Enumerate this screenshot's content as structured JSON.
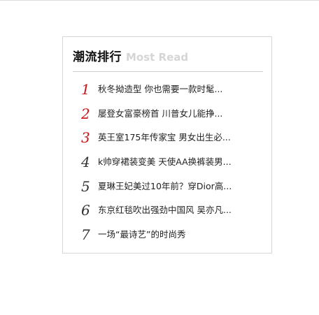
{
  "widget": {
    "title_cn": "潮流排行",
    "title_en": "Most Read",
    "items": [
      {
        "rank": "1",
        "headline": "秋冬拗造型 你也需要一款时髦..."
      },
      {
        "rank": "2",
        "headline": "屡登女富豪榜首 川普女儿能挣..."
      },
      {
        "rank": "3",
        "headline": "英王室175年传家宝 男女出生必..."
      },
      {
        "rank": "4",
        "headline": "k帅穿裙装变美 天使AA换裤装男..."
      },
      {
        "rank": "5",
        "headline": "夏琳王妃美过10年前？穿Dior高..."
      },
      {
        "rank": "6",
        "headline": "东京红毯吹出强劲中国风 吴亦凡..."
      },
      {
        "rank": "7",
        "headline": "一场“最诗艺”的时尚秀"
      }
    ]
  },
  "colors": {
    "top_rank": "#c81414",
    "rank": "#333333",
    "subtitle": "#d5d5d5",
    "border": "#d6d6d6"
  }
}
